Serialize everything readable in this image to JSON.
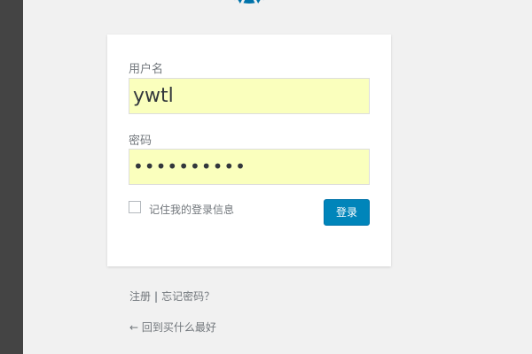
{
  "logo": {
    "icon": "wordpress-logo-icon",
    "color": "#0073aa"
  },
  "login_form": {
    "username_label": "用户名",
    "username_value": "ywtl",
    "password_label": "密码",
    "password_value": "••••••••••",
    "remember_label": "记住我的登录信息",
    "submit_label": "登录",
    "accent_color": "#0085ba",
    "autofill_color": "#faffbd"
  },
  "nav": {
    "register_label": "注册",
    "separator": "|",
    "lost_password_label": "忘记密码？",
    "back_label": "← 回到买什么最好"
  }
}
